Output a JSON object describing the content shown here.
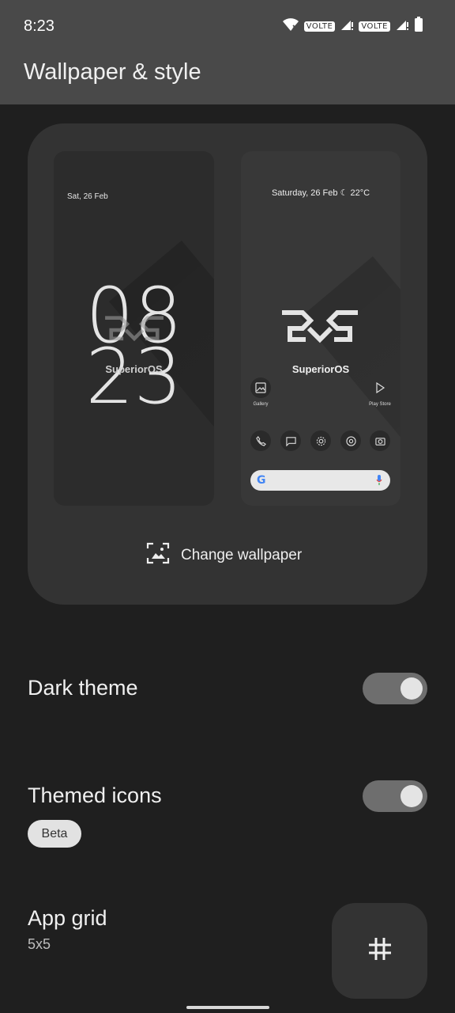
{
  "status_bar": {
    "time": "8:23",
    "volte_1": "VOLTE",
    "volte_2": "VOLTE"
  },
  "app_bar": {
    "title": "Wallpaper & style"
  },
  "preview": {
    "lock": {
      "date": "Sat, 26 Feb",
      "clock_hours": "08",
      "clock_minutes": "23",
      "brand": "SuperiorOS"
    },
    "home": {
      "date": "Saturday, 26 Feb ☾ 22°C",
      "brand": "SuperiorOS",
      "apps": [
        "Gallery",
        "Play Store"
      ]
    },
    "change_wallpaper_label": "Change wallpaper"
  },
  "settings": {
    "dark_theme": {
      "label": "Dark theme",
      "enabled": true
    },
    "themed_icons": {
      "label": "Themed icons",
      "badge": "Beta",
      "enabled": true
    },
    "app_grid": {
      "label": "App grid",
      "value": "5x5"
    }
  }
}
